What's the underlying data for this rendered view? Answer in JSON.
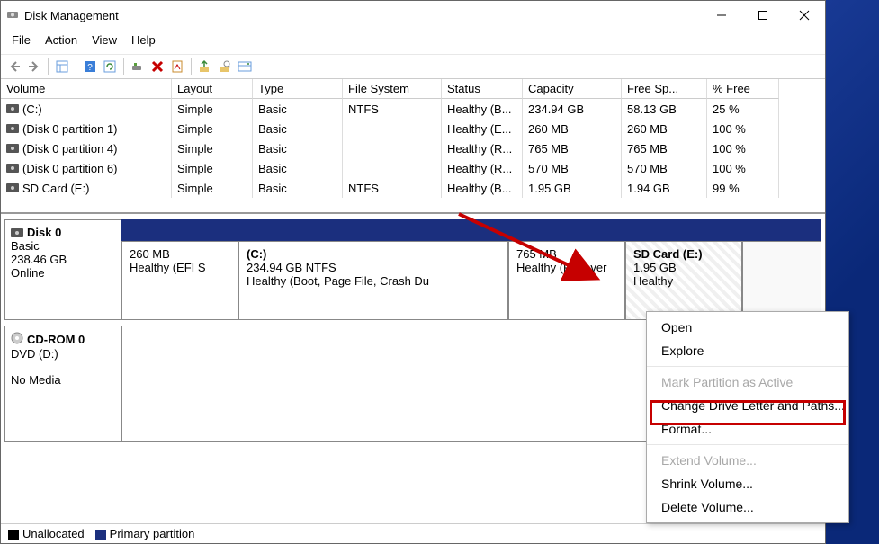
{
  "titlebar": {
    "title": "Disk Management"
  },
  "menus": [
    "File",
    "Action",
    "View",
    "Help"
  ],
  "columns": {
    "volume": "Volume",
    "layout": "Layout",
    "type": "Type",
    "fs": "File System",
    "status": "Status",
    "capacity": "Capacity",
    "free": "Free Sp...",
    "pct": "% Free"
  },
  "volumes": [
    {
      "name": "(C:)",
      "layout": "Simple",
      "type": "Basic",
      "fs": "NTFS",
      "status": "Healthy (B...",
      "capacity": "234.94 GB",
      "free": "58.13 GB",
      "pct": "25 %"
    },
    {
      "name": "(Disk 0 partition 1)",
      "layout": "Simple",
      "type": "Basic",
      "fs": "",
      "status": "Healthy (E...",
      "capacity": "260 MB",
      "free": "260 MB",
      "pct": "100 %"
    },
    {
      "name": "(Disk 0 partition 4)",
      "layout": "Simple",
      "type": "Basic",
      "fs": "",
      "status": "Healthy (R...",
      "capacity": "765 MB",
      "free": "765 MB",
      "pct": "100 %"
    },
    {
      "name": "(Disk 0 partition 6)",
      "layout": "Simple",
      "type": "Basic",
      "fs": "",
      "status": "Healthy (R...",
      "capacity": "570 MB",
      "free": "570 MB",
      "pct": "100 %"
    },
    {
      "name": "SD Card (E:)",
      "layout": "Simple",
      "type": "Basic",
      "fs": "NTFS",
      "status": "Healthy (B...",
      "capacity": "1.95 GB",
      "free": "1.94 GB",
      "pct": "99 %"
    }
  ],
  "disk0": {
    "title": "Disk 0",
    "type": "Basic",
    "size": "238.46 GB",
    "status": "Online",
    "parts": [
      {
        "title": "",
        "line1": "260 MB",
        "line2": "Healthy (EFI S"
      },
      {
        "title": "(C:)",
        "line1": "234.94 GB NTFS",
        "line2": "Healthy (Boot, Page File, Crash Du"
      },
      {
        "title": "",
        "line1": "765 MB",
        "line2": "Healthy (Recover"
      },
      {
        "title": "SD Card  (E:)",
        "line1": "1.95 GB",
        "line2": "Healthy"
      },
      {
        "title": "",
        "line1": "",
        "line2": ""
      }
    ]
  },
  "cdrom": {
    "title": "CD-ROM 0",
    "type": "DVD (D:)",
    "status": "No Media"
  },
  "legend": {
    "unallocated": "Unallocated",
    "primary": "Primary partition"
  },
  "context_menu": {
    "open": "Open",
    "explore": "Explore",
    "mark_active": "Mark Partition as Active",
    "change_letter": "Change Drive Letter and Paths...",
    "format": "Format...",
    "extend": "Extend Volume...",
    "shrink": "Shrink Volume...",
    "delete": "Delete Volume..."
  }
}
